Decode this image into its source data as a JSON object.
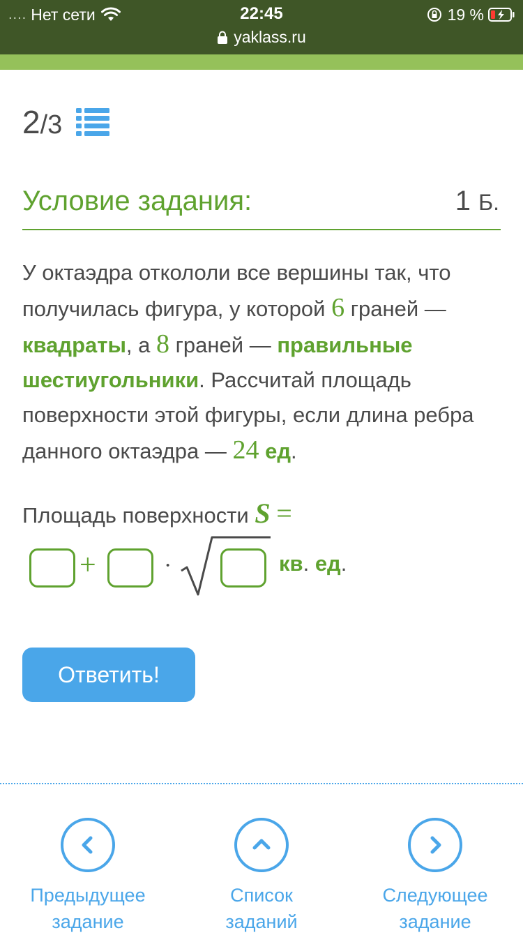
{
  "status_bar": {
    "signal": "....",
    "carrier": "Нет сети",
    "time": "22:45",
    "battery": "19 %",
    "url": "yaklass.ru"
  },
  "task_counter": {
    "current": "2",
    "separator": "/",
    "total": "3"
  },
  "condition": {
    "title": "Условие задания:",
    "points_value": "1",
    "points_unit": "Б."
  },
  "problem": {
    "t1": "У октаэдра откололи все вершины так, что получилась фигура, у которой ",
    "n1": "6",
    "t2": " граней — ",
    "h1": "квадраты",
    "t3": ", а ",
    "n2": "8",
    "t4": " граней — ",
    "h2": "правильные шестиугольники",
    "t5": ". Рассчитай площадь поверхности этой фигуры, если длина ребра данного октаэдра — ",
    "n3": "24",
    "h3": "ед",
    "t6": "."
  },
  "answer_row": {
    "label": "Площадь поверхности ",
    "var": "S",
    "eq": "=",
    "plus": "+",
    "dot": "·",
    "units": "кв",
    "units_dot": ".",
    "units2": " ед",
    "units_dot2": "."
  },
  "submit": {
    "label": "Ответить!"
  },
  "nav": {
    "prev": {
      "line1": "Предыдущее",
      "line2": "задание"
    },
    "list": {
      "line1": "Список",
      "line2": "заданий"
    },
    "next": {
      "line1": "Следующее",
      "line2": "задание"
    }
  },
  "colors": {
    "accent_green": "#5fa22f",
    "accent_blue": "#4aa6e9",
    "status_bar": "#3f5627",
    "top_stripe": "#95c15a"
  }
}
